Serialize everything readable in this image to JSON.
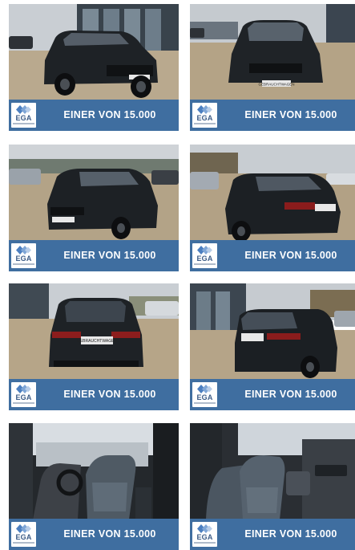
{
  "brand": {
    "logo_text": "EGA",
    "banner_color": "#3f6ea0"
  },
  "tiles": [
    {
      "caption": "EINER VON 15.000",
      "plate": "GEBRAUCHTWAGEN",
      "view": "front-three-quarter"
    },
    {
      "caption": "EINER VON 15.000",
      "plate": "GEBRAUCHTWAGEN",
      "view": "front"
    },
    {
      "caption": "EINER VON 15.000",
      "plate": "GEBRAUCHTWAGEN",
      "view": "front-left"
    },
    {
      "caption": "EINER VON 15.000",
      "plate": "GEBRAUCHTWAGEN",
      "view": "rear-three-quarter"
    },
    {
      "caption": "EINER VON 15.000",
      "plate": "GEBRAUCHTWAGEN",
      "view": "rear"
    },
    {
      "caption": "EINER VON 15.000",
      "plate": "GEBRAUCHTWAGEN",
      "view": "rear-right"
    },
    {
      "caption": "EINER VON 15.000",
      "plate": "",
      "view": "interior-front-seats"
    },
    {
      "caption": "EINER VON 15.000",
      "plate": "",
      "view": "interior-passenger-side"
    }
  ]
}
